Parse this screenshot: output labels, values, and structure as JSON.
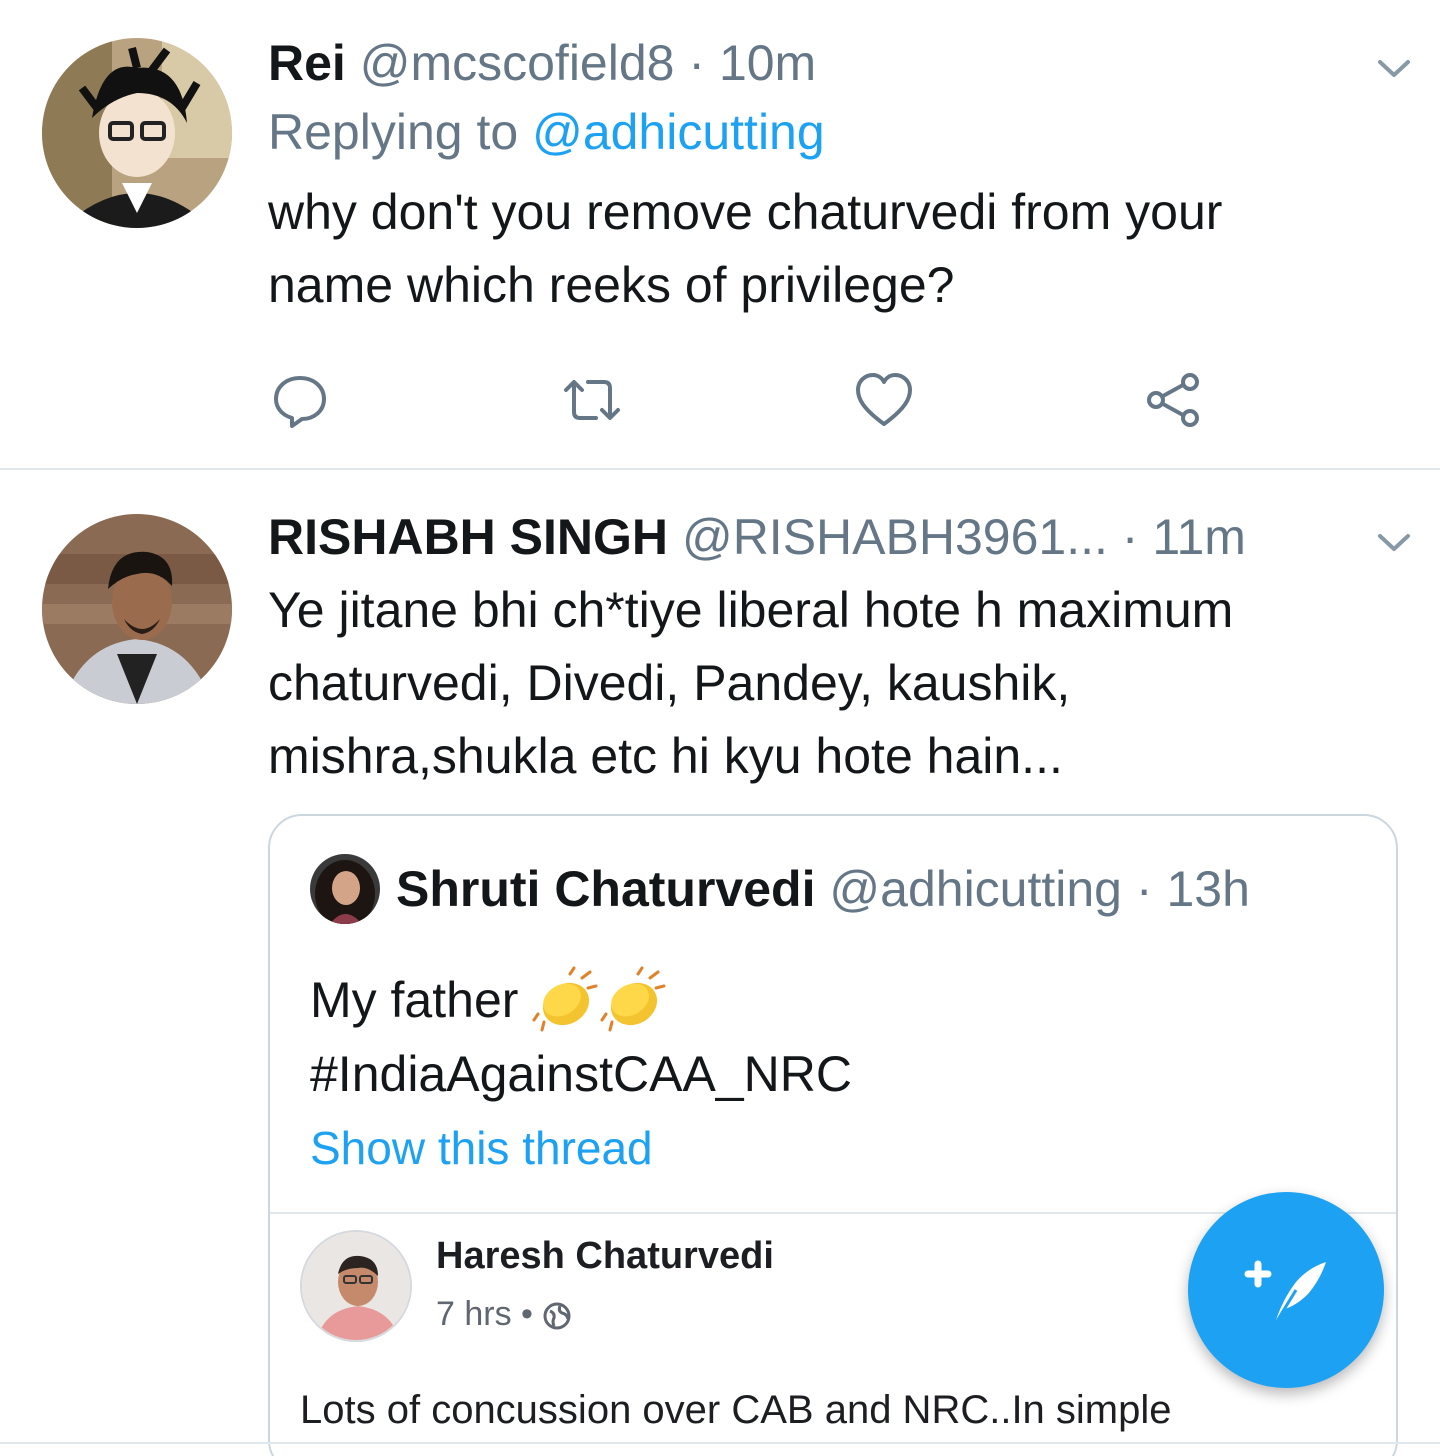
{
  "tweets": [
    {
      "name": "Rei",
      "handle": "@mcscofield8",
      "separator": "·",
      "time": "10m",
      "replying_prefix": "Replying to",
      "replying_handle": "@adhicutting",
      "text_line1": "why don't you remove chaturvedi from your",
      "text_line2": "name which reeks of privilege?",
      "actions": [
        "reply-icon",
        "retweet-icon",
        "like-icon",
        "share-icon"
      ]
    },
    {
      "name": "RISHABH SINGH",
      "handle": "@RISHABH3961...",
      "separator": "·",
      "time": "11m",
      "text_line1": "Ye jitane bhi ch*tiye liberal hote h maximum",
      "text_line2": "chaturvedi, Divedi, Pandey, kaushik,",
      "text_line3": "mishra,shukla etc hi kyu hote hain...",
      "quote": {
        "name": "Shruti Chaturvedi",
        "handle": "@adhicutting",
        "separator": "·",
        "time": "13h",
        "text_line1": "My father",
        "emoji": [
          "clapping-hands",
          "clapping-hands"
        ],
        "text_line2": "#IndiaAgainstCAA_NRC",
        "show_thread": "Show this thread",
        "media": {
          "name": "Haresh Chaturvedi",
          "time": "7 hrs",
          "meta_separator": "•",
          "visibility_icon": "globe-icon",
          "text": "Lots of concussion over CAB and NRC..In simple"
        }
      }
    }
  ],
  "fab": {
    "icon": "compose-tweet-icon"
  },
  "colors": {
    "accent": "#1da1f2",
    "text": "#14171a",
    "secondary": "#657786",
    "border": "#e1e8ed"
  }
}
